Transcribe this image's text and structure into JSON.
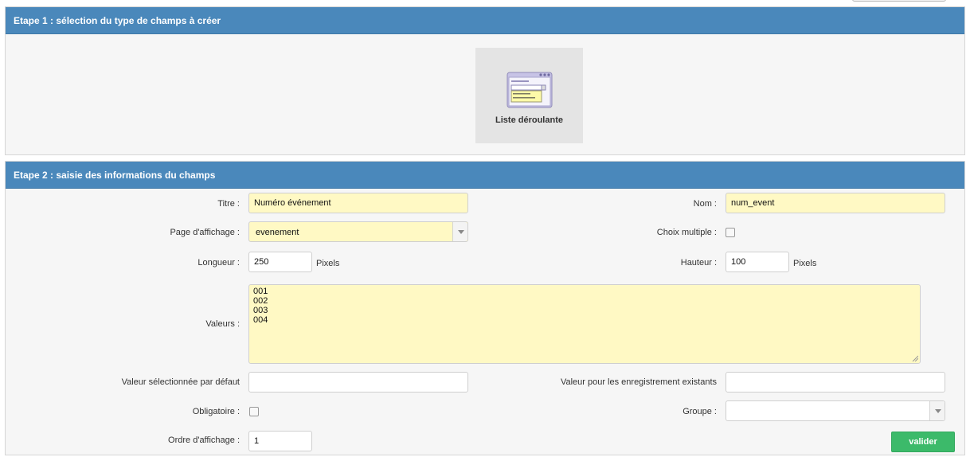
{
  "step1": {
    "title": "Etape 1 : sélection du type de champs à créer",
    "field_type": {
      "label": "Liste déroulante",
      "icon": "dropdown-list-icon"
    }
  },
  "step2": {
    "title": "Etape 2 : saisie des informations du champs",
    "titre": {
      "label": "Titre :",
      "value": "Numéro événement"
    },
    "nom": {
      "label": "Nom :",
      "value": "num_event"
    },
    "page_affichage": {
      "label": "Page d'affichage :",
      "value": "evenement"
    },
    "choix_multiple": {
      "label": "Choix multiple :",
      "checked": false
    },
    "longueur": {
      "label": "Longueur :",
      "value": "250",
      "unit": "Pixels"
    },
    "hauteur": {
      "label": "Hauteur :",
      "value": "100",
      "unit": "Pixels"
    },
    "valeurs": {
      "label": "Valeurs :",
      "lines": [
        "001",
        "002",
        "003",
        "004"
      ]
    },
    "valeur_defaut": {
      "label": "Valeur sélectionnée par défaut",
      "value": ""
    },
    "valeur_existants": {
      "label": "Valeur pour les enregistrement existants",
      "value": ""
    },
    "obligatoire": {
      "label": "Obligatoire :",
      "checked": false
    },
    "groupe": {
      "label": "Groupe :",
      "value": ""
    },
    "ordre": {
      "label": "Ordre d'affichage :",
      "value": "1"
    },
    "submit_label": "valider"
  },
  "colors": {
    "header_blue": "#4a88bb",
    "field_yellow": "#fff9c4",
    "submit_green": "#3cba6a"
  }
}
